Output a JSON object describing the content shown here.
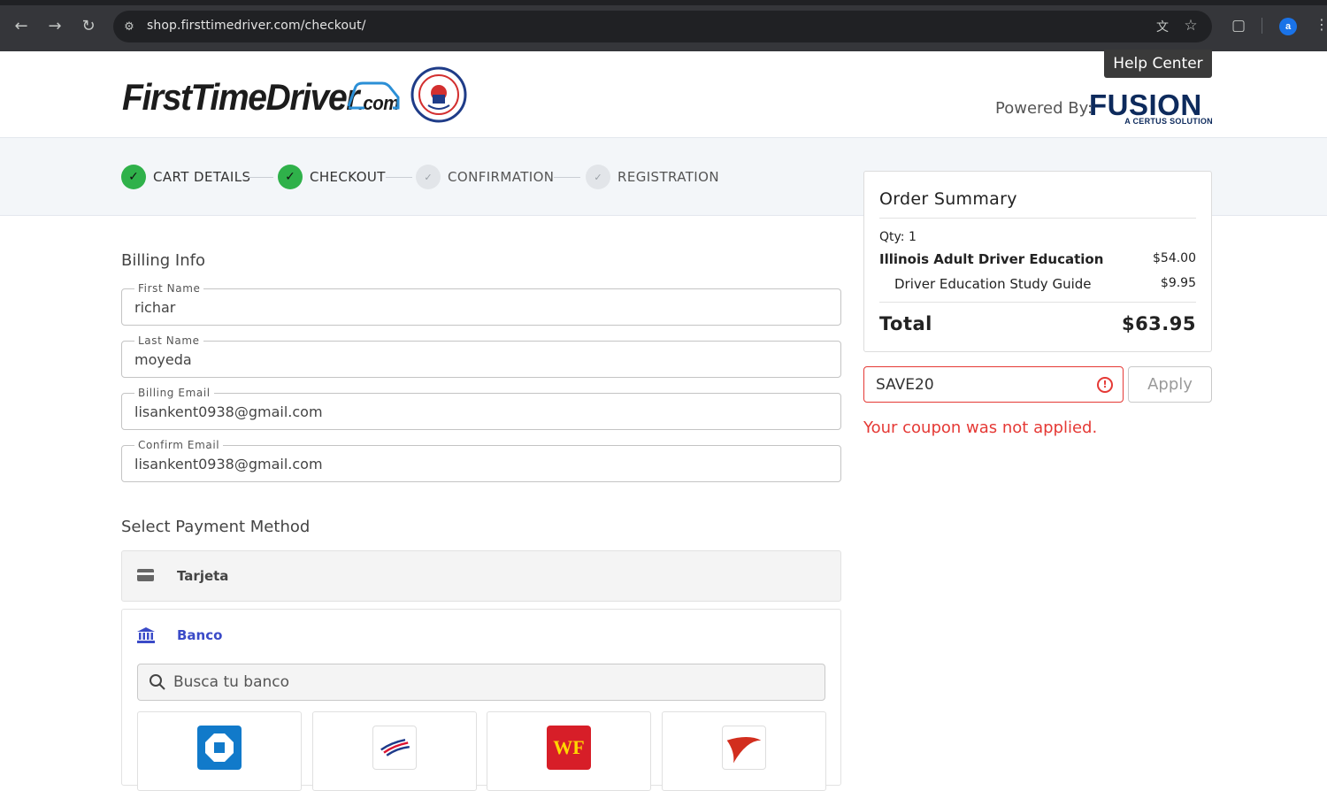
{
  "browser": {
    "url": "shop.firsttimedriver.com/checkout/",
    "profile_initial": "a",
    "icons": [
      "back-icon",
      "forward-icon",
      "reload-icon",
      "site-info-icon",
      "translate-icon",
      "star-icon",
      "extensions-icon",
      "more-vert-icon"
    ]
  },
  "header": {
    "brand_name": "FirstTimeDriver",
    "brand_suffix": ".com",
    "seal_text": "AMERICAN SAFETY COUNCIL",
    "help_center_label": "Help Center",
    "powered_by_label": "Powered By:",
    "partner_name": "FUSION",
    "partner_subtitle": "A CERTUS SOLUTION"
  },
  "steps": [
    {
      "label": "CART DETAILS",
      "status": "done"
    },
    {
      "label": "CHECKOUT",
      "status": "done"
    },
    {
      "label": "CONFIRMATION",
      "status": "pending"
    },
    {
      "label": "REGISTRATION",
      "status": "pending"
    }
  ],
  "billing": {
    "title": "Billing Info",
    "fields": [
      {
        "label": "First Name",
        "value": "richar"
      },
      {
        "label": "Last Name",
        "value": "moyeda"
      },
      {
        "label": "Billing Email",
        "value": "lisankent0938@gmail.com"
      },
      {
        "label": "Confirm Email",
        "value": "lisankent0938@gmail.com"
      }
    ]
  },
  "payment": {
    "title": "Select Payment Method",
    "card_label": "Tarjeta",
    "bank_label": "Banco",
    "bank_search_placeholder": "Busca tu banco",
    "bank_logos": [
      {
        "name": "chase",
        "color": "#117aca"
      },
      {
        "name": "bank-of-america",
        "color": "#dc1431"
      },
      {
        "name": "wells-fargo",
        "color": "#d71e28",
        "text": "WF"
      },
      {
        "name": "capital-one",
        "color": "#d22e1e"
      }
    ]
  },
  "summary": {
    "title": "Order Summary",
    "qty": "Qty: 1",
    "items": [
      {
        "name": "Illinois Adult Driver Education",
        "price": "$54.00"
      },
      {
        "name": "Driver Education Study Guide",
        "price": "$9.95"
      }
    ],
    "total_label": "Total",
    "total_value": "$63.95"
  },
  "coupon": {
    "value": "SAVE20",
    "apply_label": "Apply",
    "error_message": "Your coupon was not applied.",
    "error_color": "#e53935"
  },
  "colors": {
    "step_done": "#2fb14a",
    "bank_accent": "#3b4bc8",
    "partner_navy": "#0d2a5c"
  }
}
